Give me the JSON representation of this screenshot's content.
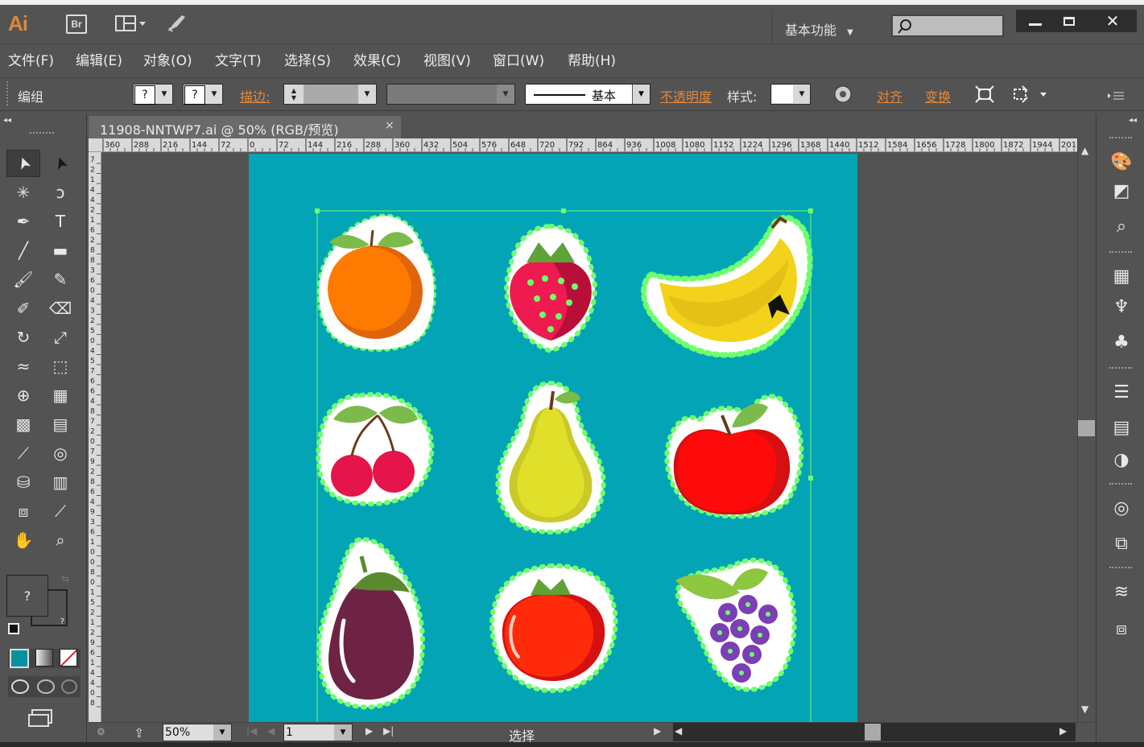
{
  "app": {
    "logo": "Ai",
    "bridge": "Br",
    "workspace": "基本功能"
  },
  "menu": [
    "文件(F)",
    "编辑(E)",
    "对象(O)",
    "文字(T)",
    "选择(S)",
    "效果(C)",
    "视图(V)",
    "窗口(W)",
    "帮助(H)"
  ],
  "control": {
    "selection_label": "编组",
    "fill_q": "?",
    "stroke_q": "?",
    "stroke_label": "描边:",
    "stroke_style": "基本",
    "opacity": "不透明度",
    "style_label": "样式:",
    "align": "对齐",
    "transform": "变换"
  },
  "document": {
    "tab_title": "11908-NNTWP7.ai @ 50% (RGB/预览)",
    "close": "×"
  },
  "ruler_h": [
    "360",
    "288",
    "216",
    "144",
    "72",
    "0",
    "72",
    "144",
    "216",
    "288",
    "360",
    "432",
    "504",
    "576",
    "648",
    "720",
    "792",
    "864",
    "936",
    "1008",
    "1080",
    "1152",
    "1224",
    "1296",
    "1368",
    "1440",
    "1512",
    "1584",
    "1656",
    "1728",
    "1800",
    "1872",
    "1944",
    "201"
  ],
  "ruler_v": [
    "7",
    "2",
    "1",
    "4",
    "4",
    "2",
    "1",
    "6",
    "2",
    "8",
    "8",
    "3",
    "6",
    "0",
    "4",
    "3",
    "2",
    "5",
    "0",
    "4",
    "5",
    "7",
    "6",
    "6",
    "4",
    "8",
    "7",
    "2",
    "0",
    "7",
    "9",
    "2",
    "8",
    "6",
    "4",
    "9",
    "3",
    "6",
    "1",
    "0",
    "0",
    "8",
    "0",
    "1",
    "5",
    "2",
    "1",
    "2",
    "9",
    "6",
    "1",
    "4",
    "4",
    "0",
    "8"
  ],
  "colors": {
    "artboard": "#03a4b6",
    "accent": "#d9883a",
    "path": "#5dff5d"
  },
  "status": {
    "zoom": "50%",
    "page": "1",
    "tool": "选择"
  },
  "tools_left": [
    "selection-tool-icon",
    "direct-selection-tool-icon",
    "magic-wand-icon",
    "lasso-icon",
    "pen-icon",
    "type-icon",
    "line-icon",
    "rectangle-icon",
    "paintbrush-icon",
    "pencil-icon",
    "blob-brush-icon",
    "eraser-icon",
    "rotate-icon",
    "scale-icon",
    "warp-icon",
    "free-transform-icon",
    "shape-builder-icon",
    "perspective-grid-icon",
    "mesh-icon",
    "gradient-icon",
    "eyedropper-icon",
    "blend-icon",
    "symbol-sprayer-icon",
    "column-graph-icon",
    "artboard-icon",
    "slice-icon",
    "hand-icon",
    "zoom-icon"
  ],
  "fruits": [
    "orange",
    "strawberry",
    "banana",
    "cherry",
    "pear",
    "apple",
    "eggplant",
    "tomato",
    "grape"
  ]
}
